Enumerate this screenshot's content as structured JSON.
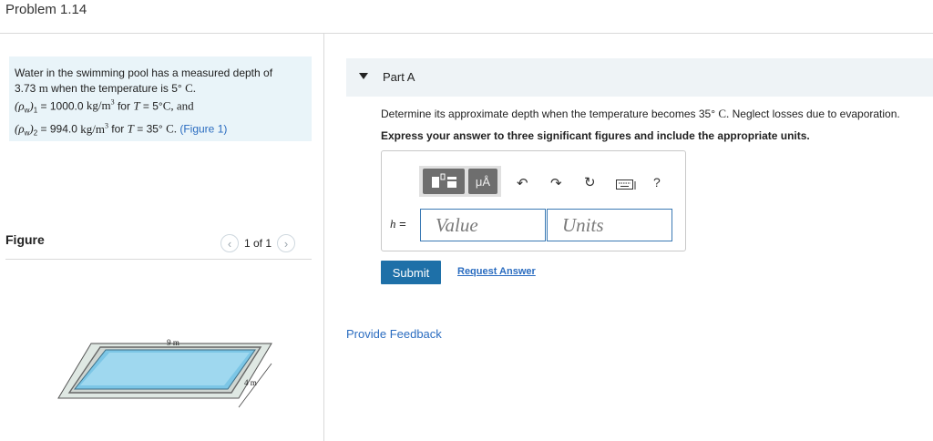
{
  "header": {
    "title": "Problem 1.14"
  },
  "problem": {
    "line1": "Water in the swimming pool has a measured depth of",
    "depth_value": "3.73",
    "depth_unit": "m",
    "line2_mid": "when the temperature is 5°",
    "temp_unit": "C.",
    "rho1_sym": "(ρ",
    "rho1_sub": "w",
    "rho1_close": ")",
    "rho1_idx": "1",
    "rho1_eq": "= 1000.0",
    "rho_unit": "kg/m",
    "rho_unit_exp": "3",
    "rho1_for": "for",
    "T_sym": "T",
    "rho1_temp": "= 5°",
    "rho1_tail": "C, and",
    "rho2_sym": "(ρ",
    "rho2_sub": "w",
    "rho2_close": ")",
    "rho2_idx": "2",
    "rho2_eq": "= 994.0",
    "rho2_for": "for",
    "rho2_temp": "= 35°",
    "rho2_unit_c": "C.",
    "figure_link": "(Figure 1)"
  },
  "figure": {
    "label": "Figure",
    "pager_text": "1 of 1",
    "dim_length": "9 m",
    "dim_width": "4 m"
  },
  "partA": {
    "label": "Part A",
    "question_pre": "Determine its approximate depth when the temperature becomes 35°",
    "question_unit": "C.",
    "question_post": "Neglect losses due to evaporation.",
    "instruction": "Express your answer to three significant figures and include the appropriate units.",
    "toolbar": {
      "template_icon": "template-icon",
      "units_label": "μÅ",
      "undo_icon": "undo-icon",
      "redo_icon": "redo-icon",
      "reset_icon": "reset-icon",
      "keyboard_icon": "keyboard-icon",
      "help_label": "?"
    },
    "var_label": "h",
    "eq_sign": "=",
    "value_placeholder": "Value",
    "units_placeholder": "Units",
    "submit_label": "Submit",
    "request_label": "Request Answer"
  },
  "feedback": {
    "label": "Provide Feedback"
  },
  "colors": {
    "accent": "#1e70a8",
    "link": "#2a6cc0",
    "problem_bg": "#e9f4f9",
    "input_border": "#3a79b4"
  }
}
